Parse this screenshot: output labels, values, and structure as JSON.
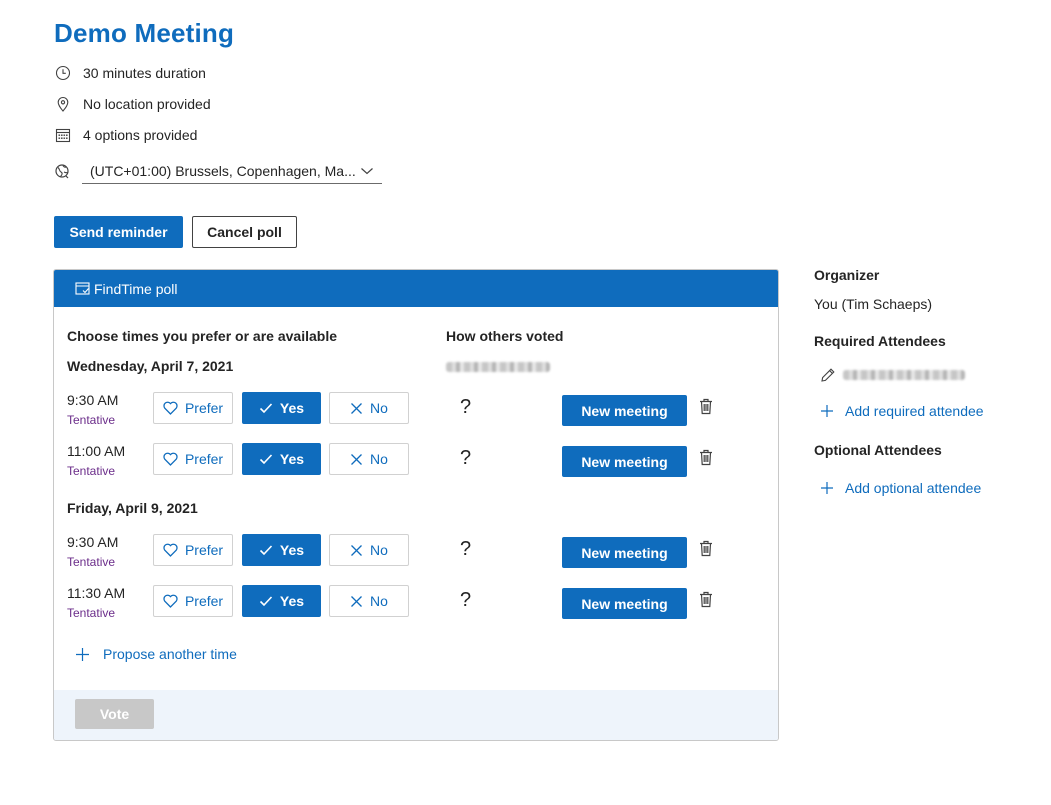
{
  "meeting": {
    "title": "Demo Meeting",
    "duration": "30 minutes duration",
    "location": "No location provided",
    "options": "4 options provided",
    "timezone": "(UTC+01:00) Brussels, Copenhagen, Ma..."
  },
  "actions": {
    "send_reminder": "Send reminder",
    "cancel_poll": "Cancel poll"
  },
  "poll": {
    "header": "FindTime poll",
    "choose_label": "Choose times you prefer or are available",
    "others_label": "How others voted",
    "dates": [
      {
        "label": "Wednesday, April 7, 2021",
        "slots": [
          {
            "time": "9:30 AM",
            "status": "Tentative",
            "others": "?",
            "selected": "Yes"
          },
          {
            "time": "11:00 AM",
            "status": "Tentative",
            "others": "?",
            "selected": "Yes"
          }
        ]
      },
      {
        "label": "Friday, April 9, 2021",
        "slots": [
          {
            "time": "9:30 AM",
            "status": "Tentative",
            "others": "?",
            "selected": "Yes"
          },
          {
            "time": "11:30 AM",
            "status": "Tentative",
            "others": "?",
            "selected": "Yes"
          }
        ]
      }
    ],
    "option_labels": {
      "prefer": "Prefer",
      "yes": "Yes",
      "no": "No"
    },
    "new_meeting": "New meeting",
    "propose": "Propose another time",
    "vote": "Vote"
  },
  "sidebar": {
    "organizer_heading": "Organizer",
    "organizer_name": "You (Tim Schaeps)",
    "required_heading": "Required Attendees",
    "add_required": "Add required attendee",
    "optional_heading": "Optional Attendees",
    "add_optional": "Add optional attendee"
  },
  "colors": {
    "accent": "#0f6cbd",
    "tentative": "#6b2d8a",
    "footer_bg": "#eef4fb",
    "disabled": "#c8c8c8"
  },
  "icons": [
    "clock-icon",
    "location-pin-icon",
    "calendar-icon",
    "globe-icon",
    "chevron-down-icon",
    "poll-icon",
    "heart-icon",
    "check-icon",
    "x-icon",
    "trash-icon",
    "plus-icon",
    "pencil-icon"
  ]
}
